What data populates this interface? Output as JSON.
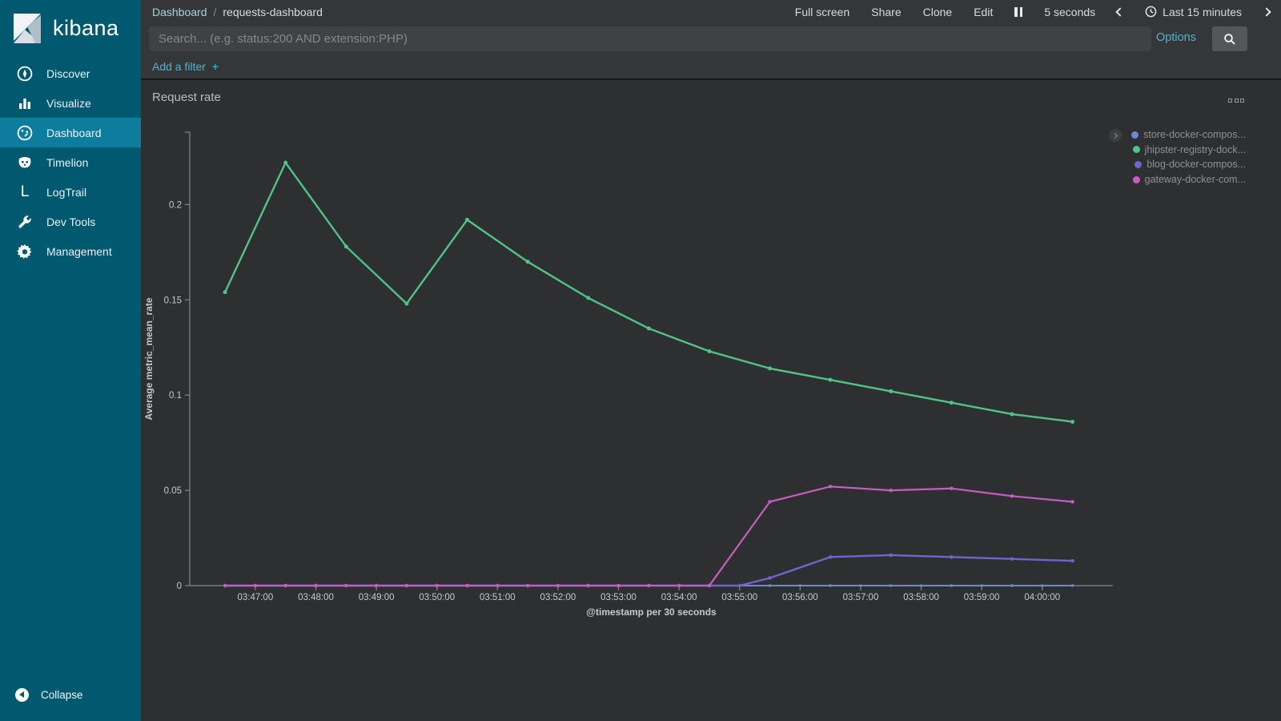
{
  "app": {
    "name": "kibana"
  },
  "sidebar": {
    "logo_text": "kibana",
    "items": [
      {
        "label": "Discover",
        "icon": "compass-icon",
        "active": false
      },
      {
        "label": "Visualize",
        "icon": "bar-chart-icon",
        "active": false
      },
      {
        "label": "Dashboard",
        "icon": "gauge-icon",
        "active": true
      },
      {
        "label": "Timelion",
        "icon": "timelion-icon",
        "active": false
      },
      {
        "label": "LogTrail",
        "icon": "logtrail-icon",
        "active": false
      },
      {
        "label": "Dev Tools",
        "icon": "wrench-icon",
        "active": false
      },
      {
        "label": "Management",
        "icon": "gear-icon",
        "active": false
      }
    ],
    "collapse_label": "Collapse"
  },
  "topbar": {
    "breadcrumb": {
      "section": "Dashboard",
      "separator": "/",
      "page": "requests-dashboard"
    },
    "menu": [
      "Full screen",
      "Share",
      "Clone",
      "Edit"
    ],
    "refresh_interval": "5 seconds",
    "time_range": "Last 15 minutes"
  },
  "search": {
    "placeholder": "Search... (e.g. status:200 AND extension:PHP)",
    "options_label": "Options"
  },
  "filter_bar": {
    "add_filter_label": "Add a filter",
    "plus": "+"
  },
  "panel": {
    "title": "Request rate"
  },
  "colors": {
    "sidebar_bg": "#00596f",
    "sidebar_active_bg": "#0e7d9d",
    "link_blue": "#56b1cd",
    "axis_line": "#83888d",
    "tick_text": "#c8c9cb",
    "series_blue": "#6f87d8",
    "series_green": "#50c487",
    "series_purple": "#7263cf",
    "series_magenta": "#c95cc3"
  },
  "chart_data": {
    "type": "line",
    "title": "Request rate",
    "xlabel": "@timestamp per 30 seconds",
    "ylabel": "Average metric_mean_rate",
    "x_domain": [
      "03:45:55",
      "04:01:10"
    ],
    "ylim": [
      0,
      0.238
    ],
    "yticks": [
      0,
      0.05,
      0.1,
      0.15,
      0.2
    ],
    "xticks": [
      "03:47:00",
      "03:48:00",
      "03:49:00",
      "03:50:00",
      "03:51:00",
      "03:52:00",
      "03:53:00",
      "03:54:00",
      "03:55:00",
      "03:56:00",
      "03:57:00",
      "03:58:00",
      "03:59:00",
      "04:00:00"
    ],
    "grid": false,
    "legend_position": "top-right",
    "series": [
      {
        "name": "store-docker-compos...",
        "color": "#6f87d8",
        "width": 2,
        "marker_r": 1.7,
        "points": [
          [
            "03:46:30",
            0
          ],
          [
            "03:47:00",
            0
          ],
          [
            "03:47:30",
            0
          ],
          [
            "03:48:00",
            0
          ],
          [
            "03:48:30",
            0
          ],
          [
            "03:49:00",
            0
          ],
          [
            "03:49:30",
            0
          ],
          [
            "03:50:00",
            0
          ],
          [
            "03:50:30",
            0
          ],
          [
            "03:51:00",
            0
          ],
          [
            "03:51:30",
            0
          ],
          [
            "03:52:00",
            0
          ],
          [
            "03:52:30",
            0
          ],
          [
            "03:53:00",
            0
          ],
          [
            "03:53:30",
            0
          ],
          [
            "03:54:00",
            0
          ],
          [
            "03:54:30",
            0
          ],
          [
            "03:55:00",
            0
          ],
          [
            "03:55:30",
            0
          ],
          [
            "03:56:00",
            0
          ],
          [
            "03:56:30",
            0
          ],
          [
            "03:57:00",
            0
          ],
          [
            "03:57:30",
            0
          ],
          [
            "03:58:00",
            0
          ],
          [
            "03:58:30",
            0
          ],
          [
            "03:59:00",
            0
          ],
          [
            "03:59:30",
            0
          ],
          [
            "04:00:00",
            0
          ],
          [
            "04:00:30",
            0
          ]
        ]
      },
      {
        "name": "blog-docker-compos...",
        "color": "#7263cf",
        "width": 2.4,
        "marker_r": 2.2,
        "points": [
          [
            "03:46:30",
            0
          ],
          [
            "03:47:00",
            0
          ],
          [
            "03:47:30",
            0
          ],
          [
            "03:48:00",
            0
          ],
          [
            "03:48:30",
            0
          ],
          [
            "03:49:00",
            0
          ],
          [
            "03:49:30",
            0
          ],
          [
            "03:50:00",
            0
          ],
          [
            "03:50:30",
            0
          ],
          [
            "03:51:00",
            0
          ],
          [
            "03:51:30",
            0
          ],
          [
            "03:52:00",
            0
          ],
          [
            "03:52:30",
            0
          ],
          [
            "03:53:00",
            0
          ],
          [
            "03:53:30",
            0
          ],
          [
            "03:54:00",
            0
          ],
          [
            "03:54:30",
            0
          ],
          [
            "03:55:00",
            0
          ],
          [
            "03:55:30",
            0.004
          ],
          [
            "03:56:30",
            0.015
          ],
          [
            "03:57:30",
            0.016
          ],
          [
            "03:58:30",
            0.015
          ],
          [
            "03:59:30",
            0.014
          ],
          [
            "04:00:30",
            0.013
          ]
        ]
      },
      {
        "name": "gateway-docker-com...",
        "color": "#c95cc3",
        "width": 2.2,
        "marker_r": 2.2,
        "points": [
          [
            "03:46:30",
            0
          ],
          [
            "03:47:00",
            0
          ],
          [
            "03:47:30",
            0
          ],
          [
            "03:48:00",
            0
          ],
          [
            "03:48:30",
            0
          ],
          [
            "03:49:00",
            0
          ],
          [
            "03:49:30",
            0
          ],
          [
            "03:50:00",
            0
          ],
          [
            "03:50:30",
            0
          ],
          [
            "03:51:00",
            0
          ],
          [
            "03:51:30",
            0
          ],
          [
            "03:52:00",
            0
          ],
          [
            "03:52:30",
            0
          ],
          [
            "03:53:00",
            0
          ],
          [
            "03:53:30",
            0
          ],
          [
            "03:54:00",
            0
          ],
          [
            "03:54:30",
            0
          ],
          [
            "03:55:30",
            0.044
          ],
          [
            "03:56:30",
            0.052
          ],
          [
            "03:57:30",
            0.05
          ],
          [
            "03:58:30",
            0.051
          ],
          [
            "03:59:30",
            0.047
          ],
          [
            "04:00:30",
            0.044
          ]
        ]
      },
      {
        "name": "jhipster-registry-dock...",
        "color": "#50c487",
        "width": 2.4,
        "marker_r": 2.5,
        "points": [
          [
            "03:46:30",
            0.154
          ],
          [
            "03:47:30",
            0.222
          ],
          [
            "03:48:30",
            0.178
          ],
          [
            "03:49:30",
            0.148
          ],
          [
            "03:50:30",
            0.192
          ],
          [
            "03:51:30",
            0.17
          ],
          [
            "03:52:30",
            0.151
          ],
          [
            "03:53:30",
            0.135
          ],
          [
            "03:54:30",
            0.123
          ],
          [
            "03:55:30",
            0.114
          ],
          [
            "03:56:30",
            0.108
          ],
          [
            "03:57:30",
            0.102
          ],
          [
            "03:58:30",
            0.096
          ],
          [
            "03:59:30",
            0.09
          ],
          [
            "04:00:30",
            0.086
          ]
        ]
      }
    ],
    "legend_order": [
      "store-docker-compos...",
      "jhipster-registry-dock...",
      "blog-docker-compos...",
      "gateway-docker-com..."
    ]
  }
}
